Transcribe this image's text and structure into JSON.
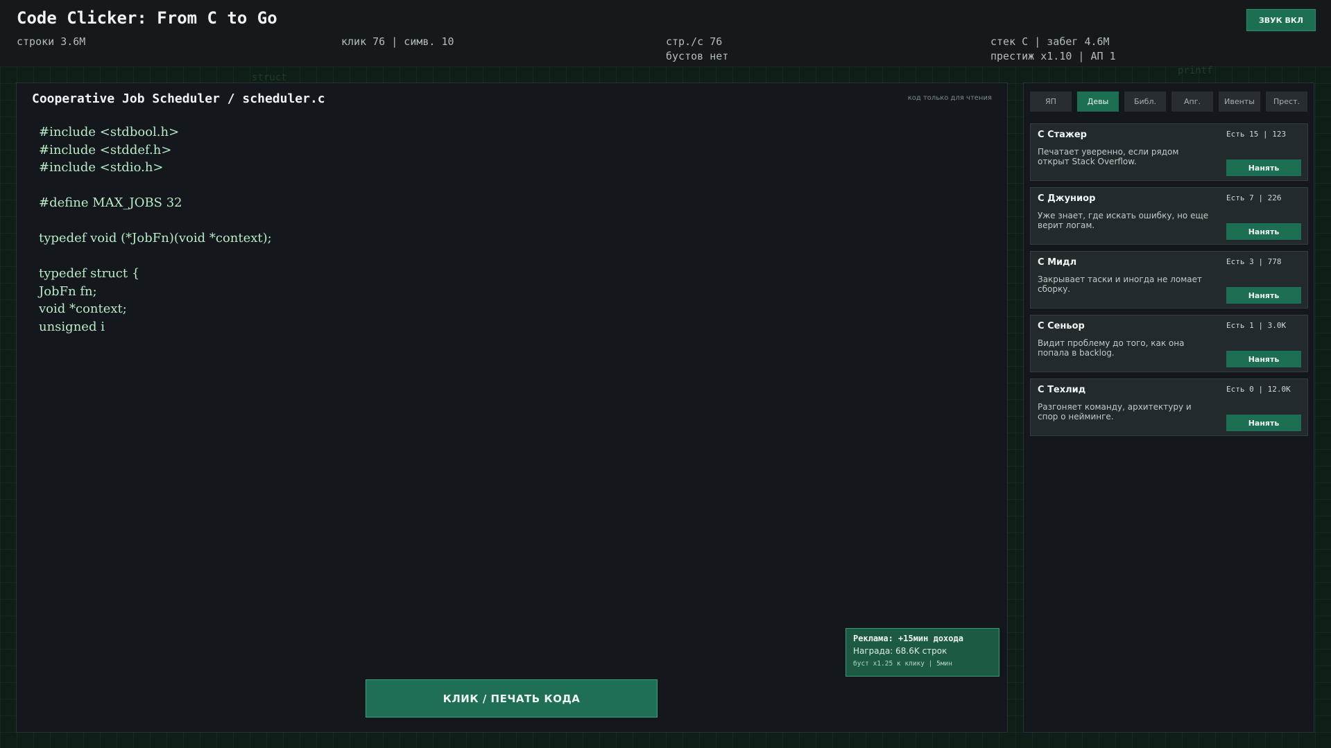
{
  "header": {
    "title": "Code Clicker: From C to Go",
    "lines": "строки 3.6M",
    "click": "клик 76 | симв. 10",
    "rate": "стр./с 76",
    "boosts": "бустов нет",
    "stack": "стек C | забег 4.6M",
    "prestige": "престиж x1.10 | АП 1",
    "sound_label": "ЗВУК ВКЛ"
  },
  "background_deco": [
    "struct",
    "printf"
  ],
  "editor": {
    "title": "Cooperative Job Scheduler / scheduler.c",
    "readonly_label": "код только для чтения",
    "code_lines": [
      "#include <stdbool.h>",
      "#include <stddef.h>",
      "#include <stdio.h>",
      "",
      "#define MAX_JOBS 32",
      "",
      "typedef void (*JobFn)(void *context);",
      "",
      "typedef struct {",
      "JobFn fn;",
      "void *context;",
      "unsigned i"
    ],
    "click_button": "КЛИК / ПЕЧАТЬ КОДА"
  },
  "ad": {
    "title": "Реклама: +15мин дохода",
    "reward": "Награда: 68.6K строк",
    "boost": "буст x1.25 к клику | 5мин"
  },
  "shop": {
    "tabs": [
      {
        "label": "ЯП",
        "active": false
      },
      {
        "label": "Девы",
        "active": true
      },
      {
        "label": "Библ.",
        "active": false
      },
      {
        "label": "Апг.",
        "active": false
      },
      {
        "label": "Ивенты",
        "active": false
      },
      {
        "label": "Прест.",
        "active": false
      }
    ],
    "cards": [
      {
        "name": "C Стажер",
        "info": "Есть 15 | 123",
        "desc": "Печатает уверенно, если рядом открыт Stack Overflow.",
        "button": "Нанять"
      },
      {
        "name": "C Джуниор",
        "info": "Есть 7 | 226",
        "desc": "Уже знает, где искать ошибку, но еще верит логам.",
        "button": "Нанять"
      },
      {
        "name": "C Мидл",
        "info": "Есть 3 | 778",
        "desc": "Закрывает таски и иногда не ломает сборку.",
        "button": "Нанять"
      },
      {
        "name": "C Сеньор",
        "info": "Есть 1 | 3.0K",
        "desc": "Видит проблему до того, как она попала в backlog.",
        "button": "Нанять"
      },
      {
        "name": "C Техлид",
        "info": "Есть 0 | 12.0K",
        "desc": "Разгоняет команду, архитектуру и спор о нейминге.",
        "button": "Нанять"
      }
    ]
  },
  "colors": {
    "accent": "#1d6f53",
    "code_text": "#b8ebc7",
    "panel": "#14181c",
    "background": "#0f1f17"
  }
}
